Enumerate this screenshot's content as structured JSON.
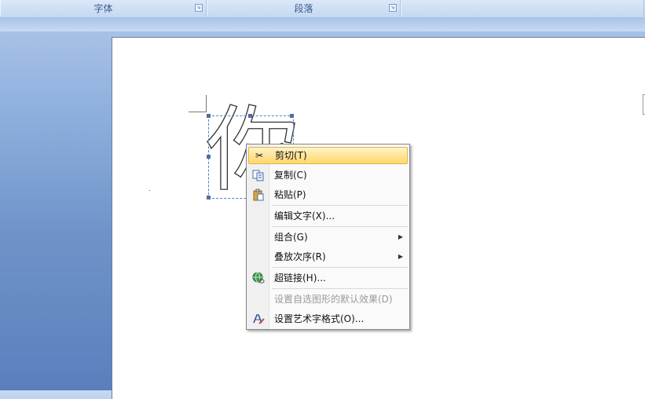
{
  "ribbon": {
    "groups": [
      {
        "label": "字体"
      },
      {
        "label": "段落"
      },
      {
        "label": ""
      }
    ],
    "launcher_icon": "dialog-launcher-icon"
  },
  "document": {
    "wordart_text": "你"
  },
  "context_menu": {
    "items": [
      {
        "label": "剪切(T)",
        "icon": "scissors-icon",
        "highlighted": true
      },
      {
        "label": "复制(C)",
        "icon": "copy-icon"
      },
      {
        "label": "粘贴(P)",
        "icon": "paste-icon"
      },
      {
        "label": "编辑文字(X)..."
      },
      {
        "label": "组合(G)",
        "submenu": true
      },
      {
        "label": "叠放次序(R)",
        "submenu": true
      },
      {
        "label": "超链接(H)...",
        "icon": "hyperlink-globe-icon"
      },
      {
        "label": "设置自选图形的默认效果(D)",
        "disabled": true
      },
      {
        "label": "设置艺术字格式(O)...",
        "icon": "format-wordart-icon"
      }
    ]
  },
  "colors": {
    "highlight_top": "#fff2c8",
    "highlight_bottom": "#ffd86b",
    "selection_border": "#4f81bd"
  }
}
